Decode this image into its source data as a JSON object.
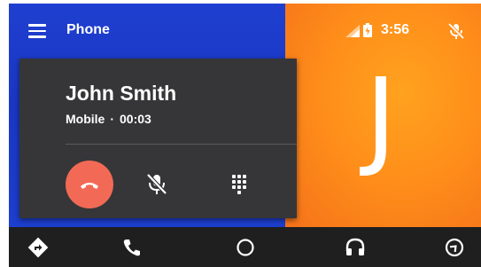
{
  "header": {
    "app_title": "Phone",
    "menu_icon": "hamburger-menu-icon",
    "signal_icon": "cell-signal-icon",
    "battery_icon": "battery-charging-icon",
    "time": "3:56",
    "mic_icon": "mic-off-icon"
  },
  "call": {
    "caller_name": "John Smith",
    "line_type": "Mobile",
    "separator": "·",
    "duration": "00:03",
    "end_call_icon": "end-call-icon",
    "mute_icon": "mic-off-icon",
    "dialpad_icon": "dialpad-icon"
  },
  "contact": {
    "avatar_initial": "J"
  },
  "nav": {
    "items": [
      {
        "name": "navigation",
        "icon": "directions-icon"
      },
      {
        "name": "phone",
        "icon": "phone-icon"
      },
      {
        "name": "home",
        "icon": "home-circle-icon"
      },
      {
        "name": "audio",
        "icon": "headphones-icon"
      },
      {
        "name": "exit",
        "icon": "exit-icon"
      }
    ]
  },
  "colors": {
    "app_bar_blue": "#1f3fd0",
    "contact_orange": "#ff8f1a",
    "card_bg": "#363638",
    "end_call_red": "#f26a55",
    "nav_bg": "#1f1f1f"
  }
}
